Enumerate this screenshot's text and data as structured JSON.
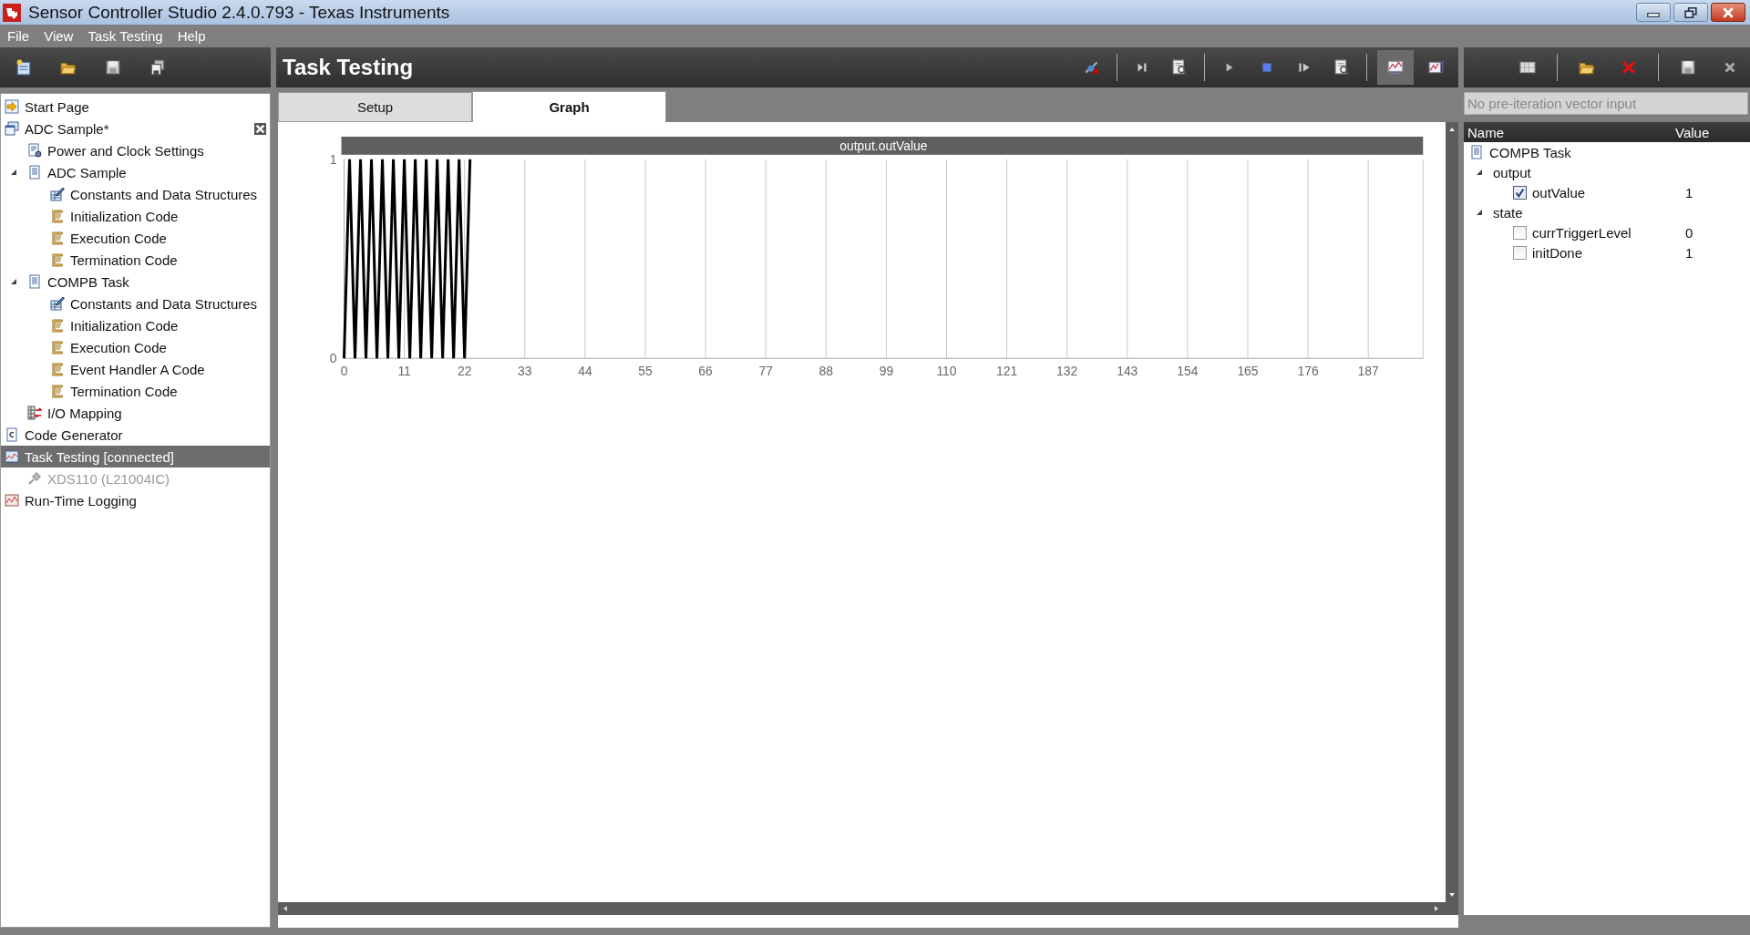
{
  "window": {
    "title": "Sensor Controller Studio 2.4.0.793 - Texas Instruments"
  },
  "menu": [
    "File",
    "View",
    "Task Testing",
    "Help"
  ],
  "project_tree": [
    {
      "label": "Start Page",
      "kind": "start",
      "selected": false,
      "disabled": false
    },
    {
      "label": "ADC Sample*",
      "kind": "project",
      "selected": false,
      "disabled": false,
      "children": [
        {
          "label": "Power and Clock Settings",
          "kind": "settings",
          "selected": false,
          "disabled": false
        },
        {
          "label": "ADC Sample",
          "kind": "task",
          "expanded": true,
          "selected": false,
          "disabled": false,
          "children": [
            {
              "label": "Constants and Data Structures",
              "kind": "constants",
              "selected": false,
              "disabled": false
            },
            {
              "label": "Initialization Code",
              "kind": "code",
              "selected": false,
              "disabled": false
            },
            {
              "label": "Execution Code",
              "kind": "code",
              "selected": false,
              "disabled": false
            },
            {
              "label": "Termination Code",
              "kind": "code",
              "selected": false,
              "disabled": false
            }
          ]
        },
        {
          "label": "COMPB Task",
          "kind": "task",
          "expanded": true,
          "selected": false,
          "disabled": false,
          "children": [
            {
              "label": "Constants and Data Structures",
              "kind": "constants",
              "selected": false,
              "disabled": false
            },
            {
              "label": "Initialization Code",
              "kind": "code",
              "selected": false,
              "disabled": false
            },
            {
              "label": "Execution Code",
              "kind": "code",
              "selected": false,
              "disabled": false
            },
            {
              "label": "Event Handler A Code",
              "kind": "code",
              "selected": false,
              "disabled": false
            },
            {
              "label": "Termination Code",
              "kind": "code",
              "selected": false,
              "disabled": false
            }
          ]
        },
        {
          "label": "I/O Mapping",
          "kind": "io",
          "selected": false,
          "disabled": false
        }
      ]
    },
    {
      "label": "Code Generator",
      "kind": "generator",
      "selected": false,
      "disabled": false
    },
    {
      "label": "Task Testing [connected]",
      "kind": "testing",
      "selected": true,
      "disabled": false,
      "children": [
        {
          "label": "XDS110 (L21004IC)",
          "kind": "device",
          "selected": false,
          "disabled": true
        }
      ]
    },
    {
      "label": "Run-Time Logging",
      "kind": "logging",
      "selected": false,
      "disabled": false
    }
  ],
  "panel": {
    "title": "Task Testing"
  },
  "toolbar": [
    {
      "selected": false
    },
    {
      "selected": false
    },
    {
      "selected": false
    },
    {
      "selected": false
    },
    {
      "selected": false
    },
    {
      "selected": false
    },
    {
      "selected": false
    },
    {
      "selected": true
    },
    {
      "selected": false
    }
  ],
  "tabs": [
    {
      "label": "Setup",
      "selected": false
    },
    {
      "label": "Graph",
      "selected": true
    }
  ],
  "graph": {
    "chart_data": {
      "type": "line",
      "grid": true,
      "x": [
        0,
        1,
        2,
        3,
        4,
        5,
        6,
        7,
        8,
        9,
        10,
        11,
        12,
        13,
        14,
        15,
        16,
        17,
        18,
        19,
        20,
        21,
        22,
        23
      ],
      "series": [
        {
          "name": "output.outValue",
          "color": "#000000",
          "values": [
            0,
            1,
            0,
            1,
            0,
            1,
            0,
            1,
            0,
            1,
            0,
            1,
            0,
            1,
            0,
            1,
            0,
            1,
            0,
            1,
            0,
            1,
            0,
            1
          ]
        }
      ],
      "xlim": [
        0,
        197
      ],
      "ylim": [
        0,
        1
      ],
      "xticks": [
        0,
        11,
        22,
        33,
        44,
        55,
        66,
        77,
        88,
        99,
        110,
        121,
        132,
        143,
        154,
        165,
        176,
        187
      ],
      "yticks": [
        0,
        1
      ]
    }
  },
  "vector_input": {
    "placeholder": "No pre-iteration vector input"
  },
  "variables": {
    "columns": [
      "Name",
      "Value"
    ],
    "root": "COMPB Task",
    "groups": [
      {
        "label": "output",
        "expanded": true,
        "items": [
          {
            "name": "outValue",
            "checked": true,
            "value": "1"
          }
        ]
      },
      {
        "label": "state",
        "expanded": true,
        "items": [
          {
            "name": "currTriggerLevel",
            "checked": false,
            "value": "0"
          },
          {
            "name": "initDone",
            "checked": false,
            "value": "1"
          }
        ]
      }
    ]
  }
}
